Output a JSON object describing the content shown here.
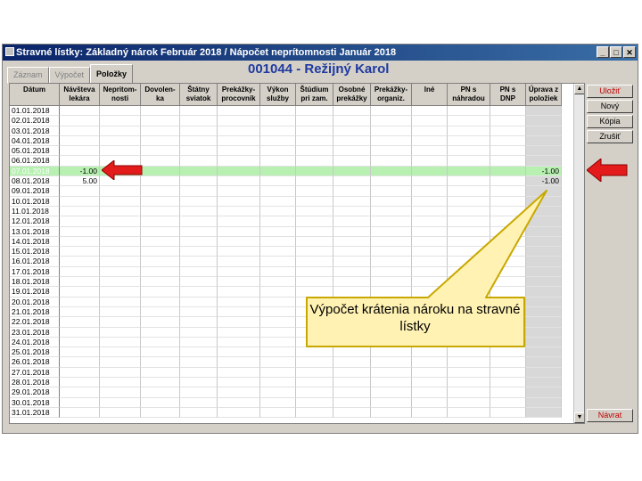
{
  "window": {
    "title": "Stravné lístky: Základný nárok Február 2018  /  Nápočet neprítomnosti Január 2018",
    "buttons": {
      "minimize": "_",
      "restore": "□",
      "close": "✕"
    }
  },
  "tabs": [
    {
      "label": "Záznam",
      "active": false
    },
    {
      "label": "Výpočet",
      "active": false
    },
    {
      "label": "Položky",
      "active": true
    }
  ],
  "employee": "001044 - Režijný Karol",
  "columns": [
    "Dátum",
    "Návšteva\nlekára",
    "Nepritom-\nnosti",
    "Dovolen-\nka",
    "Štátny\nsviatok",
    "Prekážky-\nprocovník",
    "Výkon\nslužby",
    "Štúdium\npri zam.",
    "Osobné\nprekážky",
    "Prekážky-\norganiz.",
    "Iné",
    "PN s\nnáhradou",
    "PN s\nDNP",
    "Úprava z\npoložiek"
  ],
  "rows": [
    {
      "date": "01.01.2018",
      "v": [
        "",
        "",
        "",
        "",
        "",
        "",
        "",
        "",
        "",
        "",
        "",
        "",
        ""
      ]
    },
    {
      "date": "02.01.2018",
      "v": [
        "",
        "",
        "",
        "",
        "",
        "",
        "",
        "",
        "",
        "",
        "",
        "",
        ""
      ]
    },
    {
      "date": "03.01.2018",
      "v": [
        "",
        "",
        "",
        "",
        "",
        "",
        "",
        "",
        "",
        "",
        "",
        "",
        ""
      ]
    },
    {
      "date": "04.01.2018",
      "v": [
        "",
        "",
        "",
        "",
        "",
        "",
        "",
        "",
        "",
        "",
        "",
        "",
        ""
      ]
    },
    {
      "date": "05.01.2018",
      "v": [
        "",
        "",
        "",
        "",
        "",
        "",
        "",
        "",
        "",
        "",
        "",
        "",
        ""
      ]
    },
    {
      "date": "06.01.2018",
      "v": [
        "",
        "",
        "",
        "",
        "",
        "",
        "",
        "",
        "",
        "",
        "",
        "",
        ""
      ]
    },
    {
      "date": "07.01.2018",
      "v": [
        "-1.00",
        "",
        "",
        "",
        "",
        "",
        "",
        "",
        "",
        "",
        "",
        "",
        "-1.00"
      ],
      "highlight": true
    },
    {
      "date": "08.01.2018",
      "v": [
        "5.00",
        "",
        "",
        "",
        "",
        "",
        "",
        "",
        "",
        "",
        "",
        "",
        "-1.00"
      ]
    },
    {
      "date": "09.01.2018",
      "v": [
        "",
        "",
        "",
        "",
        "",
        "",
        "",
        "",
        "",
        "",
        "",
        "",
        ""
      ]
    },
    {
      "date": "10.01.2018",
      "v": [
        "",
        "",
        "",
        "",
        "",
        "",
        "",
        "",
        "",
        "",
        "",
        "",
        ""
      ]
    },
    {
      "date": "11.01.2018",
      "v": [
        "",
        "",
        "",
        "",
        "",
        "",
        "",
        "",
        "",
        "",
        "",
        "",
        ""
      ]
    },
    {
      "date": "12.01.2018",
      "v": [
        "",
        "",
        "",
        "",
        "",
        "",
        "",
        "",
        "",
        "",
        "",
        "",
        ""
      ]
    },
    {
      "date": "13.01.2018",
      "v": [
        "",
        "",
        "",
        "",
        "",
        "",
        "",
        "",
        "",
        "",
        "",
        "",
        ""
      ]
    },
    {
      "date": "14.01.2018",
      "v": [
        "",
        "",
        "",
        "",
        "",
        "",
        "",
        "",
        "",
        "",
        "",
        "",
        ""
      ]
    },
    {
      "date": "15.01.2018",
      "v": [
        "",
        "",
        "",
        "",
        "",
        "",
        "",
        "",
        "",
        "",
        "",
        "",
        ""
      ]
    },
    {
      "date": "16.01.2018",
      "v": [
        "",
        "",
        "",
        "",
        "",
        "",
        "",
        "",
        "",
        "",
        "",
        "",
        ""
      ]
    },
    {
      "date": "17.01.2018",
      "v": [
        "",
        "",
        "",
        "",
        "",
        "",
        "",
        "",
        "",
        "",
        "",
        "",
        ""
      ]
    },
    {
      "date": "18.01.2018",
      "v": [
        "",
        "",
        "",
        "",
        "",
        "",
        "",
        "",
        "",
        "",
        "",
        "",
        ""
      ]
    },
    {
      "date": "19.01.2018",
      "v": [
        "",
        "",
        "",
        "",
        "",
        "",
        "",
        "",
        "",
        "",
        "",
        "",
        ""
      ]
    },
    {
      "date": "20.01.2018",
      "v": [
        "",
        "",
        "",
        "",
        "",
        "",
        "",
        "",
        "",
        "",
        "",
        "",
        ""
      ]
    },
    {
      "date": "21.01.2018",
      "v": [
        "",
        "",
        "",
        "",
        "",
        "",
        "",
        "",
        "",
        "",
        "",
        "",
        ""
      ]
    },
    {
      "date": "22.01.2018",
      "v": [
        "",
        "",
        "",
        "",
        "",
        "",
        "",
        "",
        "",
        "",
        "",
        "",
        ""
      ]
    },
    {
      "date": "23.01.2018",
      "v": [
        "",
        "",
        "",
        "",
        "",
        "",
        "",
        "",
        "",
        "",
        "",
        "",
        ""
      ]
    },
    {
      "date": "24.01.2018",
      "v": [
        "",
        "",
        "",
        "",
        "",
        "",
        "",
        "",
        "",
        "",
        "",
        "",
        ""
      ]
    },
    {
      "date": "25.01.2018",
      "v": [
        "",
        "",
        "",
        "",
        "",
        "",
        "",
        "",
        "",
        "",
        "",
        "",
        ""
      ]
    },
    {
      "date": "26.01.2018",
      "v": [
        "",
        "",
        "",
        "",
        "",
        "",
        "",
        "",
        "",
        "",
        "",
        "",
        ""
      ]
    },
    {
      "date": "27.01.2018",
      "v": [
        "",
        "",
        "",
        "",
        "",
        "",
        "",
        "",
        "",
        "",
        "",
        "",
        ""
      ]
    },
    {
      "date": "28.01.2018",
      "v": [
        "",
        "",
        "",
        "",
        "",
        "",
        "",
        "",
        "",
        "",
        "",
        "",
        ""
      ]
    },
    {
      "date": "29.01.2018",
      "v": [
        "",
        "",
        "",
        "",
        "",
        "",
        "",
        "",
        "",
        "",
        "",
        "",
        ""
      ]
    },
    {
      "date": "30.01.2018",
      "v": [
        "",
        "",
        "",
        "",
        "",
        "",
        "",
        "",
        "",
        "",
        "",
        "",
        ""
      ]
    },
    {
      "date": "31.01.2018",
      "v": [
        "",
        "",
        "",
        "",
        "",
        "",
        "",
        "",
        "",
        "",
        "",
        "",
        ""
      ]
    }
  ],
  "side_buttons": {
    "save": "Uložiť",
    "new": "Nový",
    "copy": "Kópia",
    "delete": "Zrušiť",
    "back": "Návrat"
  },
  "callout": "Výpočet krátenia nároku na stravné lístky",
  "colors": {
    "highlight_row": "#b7f0b1",
    "arrow": "#e31b1b",
    "callout_fill": "#fff2b3",
    "title_blue": "#1f3aa0"
  }
}
